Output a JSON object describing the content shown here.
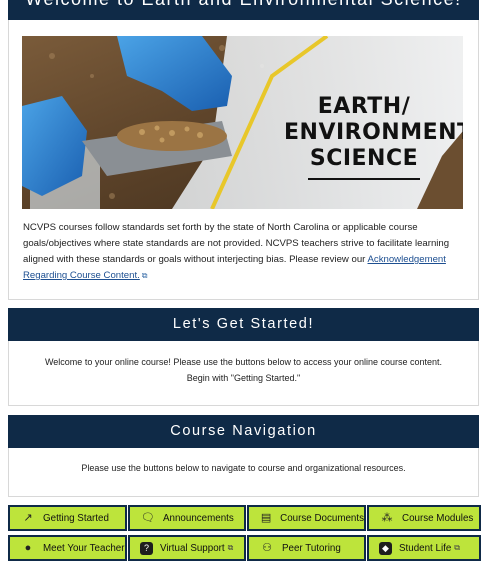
{
  "header": {
    "title": "Welcome to Earth and Environmental Science!"
  },
  "hero": {
    "title_lines": [
      "EARTH/",
      "ENVIRONMENTAL",
      "SCIENCE"
    ]
  },
  "intro": {
    "text": "NCVPS courses follow standards set forth by the state of North Carolina or applicable course goals/objectives where state standards are not provided. NCVPS teachers strive to facilitate learning aligned with these standards or goals without interjecting bias. Please review our ",
    "link_label": "Acknowledgement Regarding Course Content."
  },
  "started": {
    "heading": "Let's Get Started!",
    "line1": "Welcome to your online course! Please use the buttons below to access your online course content.",
    "line2": "Begin with \"Getting Started.\""
  },
  "navigation": {
    "heading": "Course Navigation",
    "text": "Please use the buttons below to navigate to course and organizational resources."
  },
  "buttons": [
    {
      "label": "Getting Started",
      "icon": "arrow-icon",
      "glyph": "↗"
    },
    {
      "label": "Announcements",
      "icon": "chat-icon",
      "glyph": "▭"
    },
    {
      "label": "Course Documents",
      "icon": "document-icon",
      "glyph": "▤"
    },
    {
      "label": "Course Modules",
      "icon": "modules-icon",
      "glyph": "⁂"
    },
    {
      "label": "Meet Your Teacher",
      "icon": "apple-icon",
      "glyph": "●"
    },
    {
      "label": "Virtual Support",
      "icon": "help-icon",
      "glyph": "?"
    },
    {
      "label": "Peer Tutoring",
      "icon": "people-icon",
      "glyph": "⚇"
    },
    {
      "label": "Student Life",
      "icon": "student-life-icon",
      "glyph": "◆"
    }
  ],
  "colors": {
    "navy": "#0f2a47",
    "button_green": "#bde43b",
    "link_blue": "#1d4f91"
  }
}
